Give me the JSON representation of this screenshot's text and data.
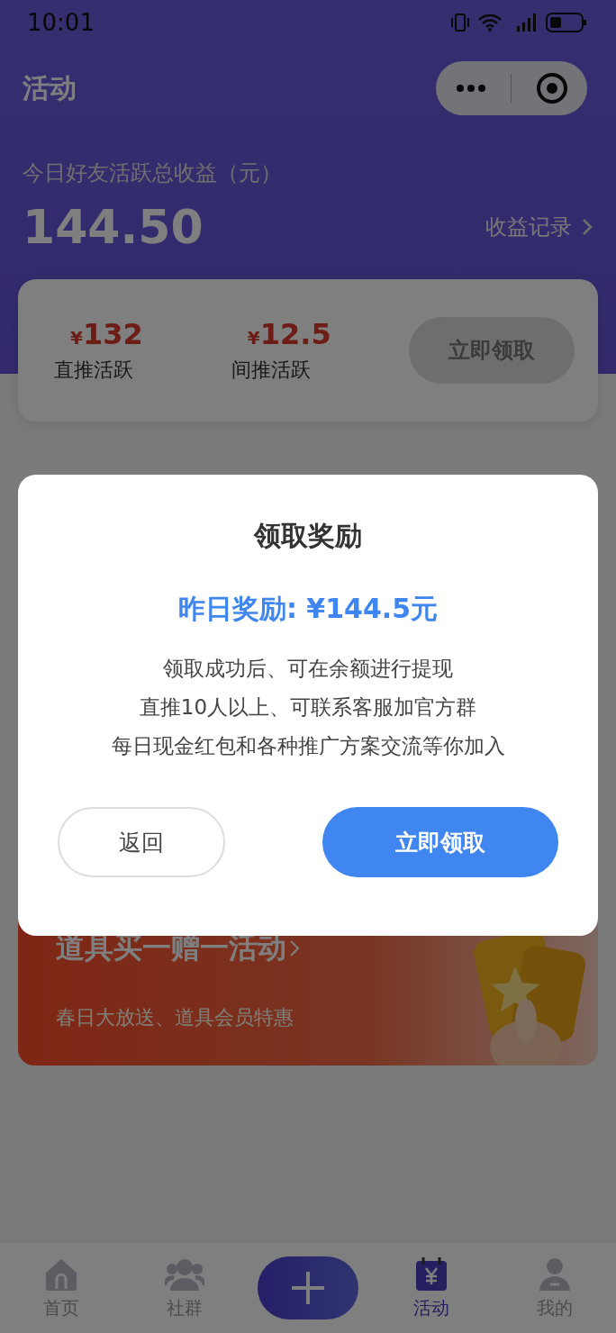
{
  "status_bar": {
    "time": "10:01"
  },
  "header": {
    "title": "活动"
  },
  "earnings": {
    "label": "今日好友活跃总收益（元）",
    "amount": "144.50",
    "record_link": "收益记录"
  },
  "summary": {
    "items": [
      {
        "currency": "¥",
        "value": "132",
        "label": "直推活跃"
      },
      {
        "currency": "¥",
        "value": "12.5",
        "label": "间推活跃"
      }
    ],
    "button": "立即领取"
  },
  "banner": {
    "title": "道具买一赠一活动",
    "subtitle": "春日大放送、道具会员特惠"
  },
  "tabs": [
    {
      "kind": "home",
      "label": "首页",
      "selected": false
    },
    {
      "kind": "group",
      "label": "社群",
      "selected": false
    },
    {
      "kind": "plus",
      "selected": false
    },
    {
      "kind": "calendar",
      "label": "活动",
      "selected": true
    },
    {
      "kind": "profile",
      "label": "我的",
      "selected": false
    }
  ],
  "dialog": {
    "title": "领取奖励",
    "reward": "昨日奖励: ¥144.5元",
    "lines": [
      "领取成功后、可在余额进行提现",
      "直推10人以上、可联系客服加官方群",
      "每日现金红包和各种推广方案交流等你加入"
    ],
    "buttons": [
      {
        "kind": "secondary",
        "label": "返回"
      },
      {
        "kind": "primary",
        "label": "立即领取"
      }
    ]
  }
}
